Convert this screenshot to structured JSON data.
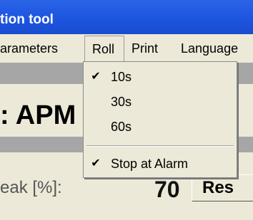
{
  "window": {
    "title": "tion tool"
  },
  "menubar": {
    "items": [
      {
        "label": "arameters"
      },
      {
        "label": "Roll"
      },
      {
        "label": "Print"
      },
      {
        "label": "Language"
      }
    ]
  },
  "main": {
    "heading": ": APM",
    "field_label": "eak [%]:",
    "field_value": "70",
    "reset_label": "Res"
  },
  "roll_menu": {
    "items": [
      {
        "label": "10s",
        "checked": true
      },
      {
        "label": "30s",
        "checked": false
      },
      {
        "label": "60s",
        "checked": false
      },
      {
        "label": "Stop at Alarm",
        "checked": true
      }
    ],
    "check_glyph": "✔"
  }
}
